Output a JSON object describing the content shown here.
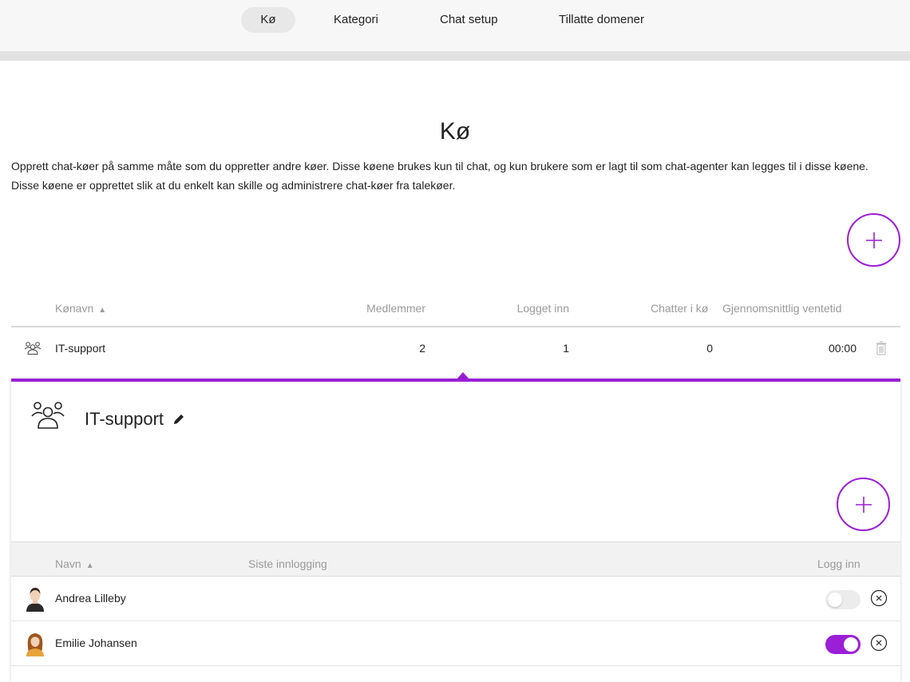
{
  "nav": {
    "tabs": [
      {
        "label": "Kø",
        "active": true
      },
      {
        "label": "Kategori",
        "active": false
      },
      {
        "label": "Chat setup",
        "active": false
      },
      {
        "label": "Tillatte domener",
        "active": false
      }
    ]
  },
  "page": {
    "title": "Kø",
    "description": "Opprett chat-køer på samme måte som du oppretter andre køer. Disse køene brukes kun til chat, og kun brukere som er lagt til som chat-agenter kan legges til i disse køene. Disse køene er opprettet slik at du enkelt kan skille og administrere chat-køer fra talekøer."
  },
  "queue_table": {
    "headers": {
      "name": "Kønavn",
      "members": "Medlemmer",
      "logged_in": "Logget inn",
      "chats_in_queue": "Chatter i kø",
      "avg_wait": "Gjennomsnittlig ventetid"
    },
    "sort_arrow": "▲",
    "rows": [
      {
        "name": "IT-support",
        "members": "2",
        "logged_in": "1",
        "chats_in_queue": "0",
        "avg_wait": "00:00"
      }
    ]
  },
  "detail": {
    "title": "IT-support",
    "members_table": {
      "headers": {
        "name": "Navn",
        "last_login": "Siste innlogging",
        "login": "Logg inn"
      },
      "rows": [
        {
          "name": "Andrea Lilleby",
          "last_login": "",
          "logged_in": false
        },
        {
          "name": "Emilie Johansen",
          "last_login": "",
          "logged_in": true
        }
      ]
    }
  },
  "colors": {
    "accent": "#9b1fd6",
    "header_text": "#9a9a9a",
    "toggle_off": "#ececec"
  },
  "icons": {
    "add": "plus-icon",
    "group": "group-icon",
    "trash": "trash-icon",
    "edit": "pencil-icon",
    "remove": "close-circle-icon"
  }
}
